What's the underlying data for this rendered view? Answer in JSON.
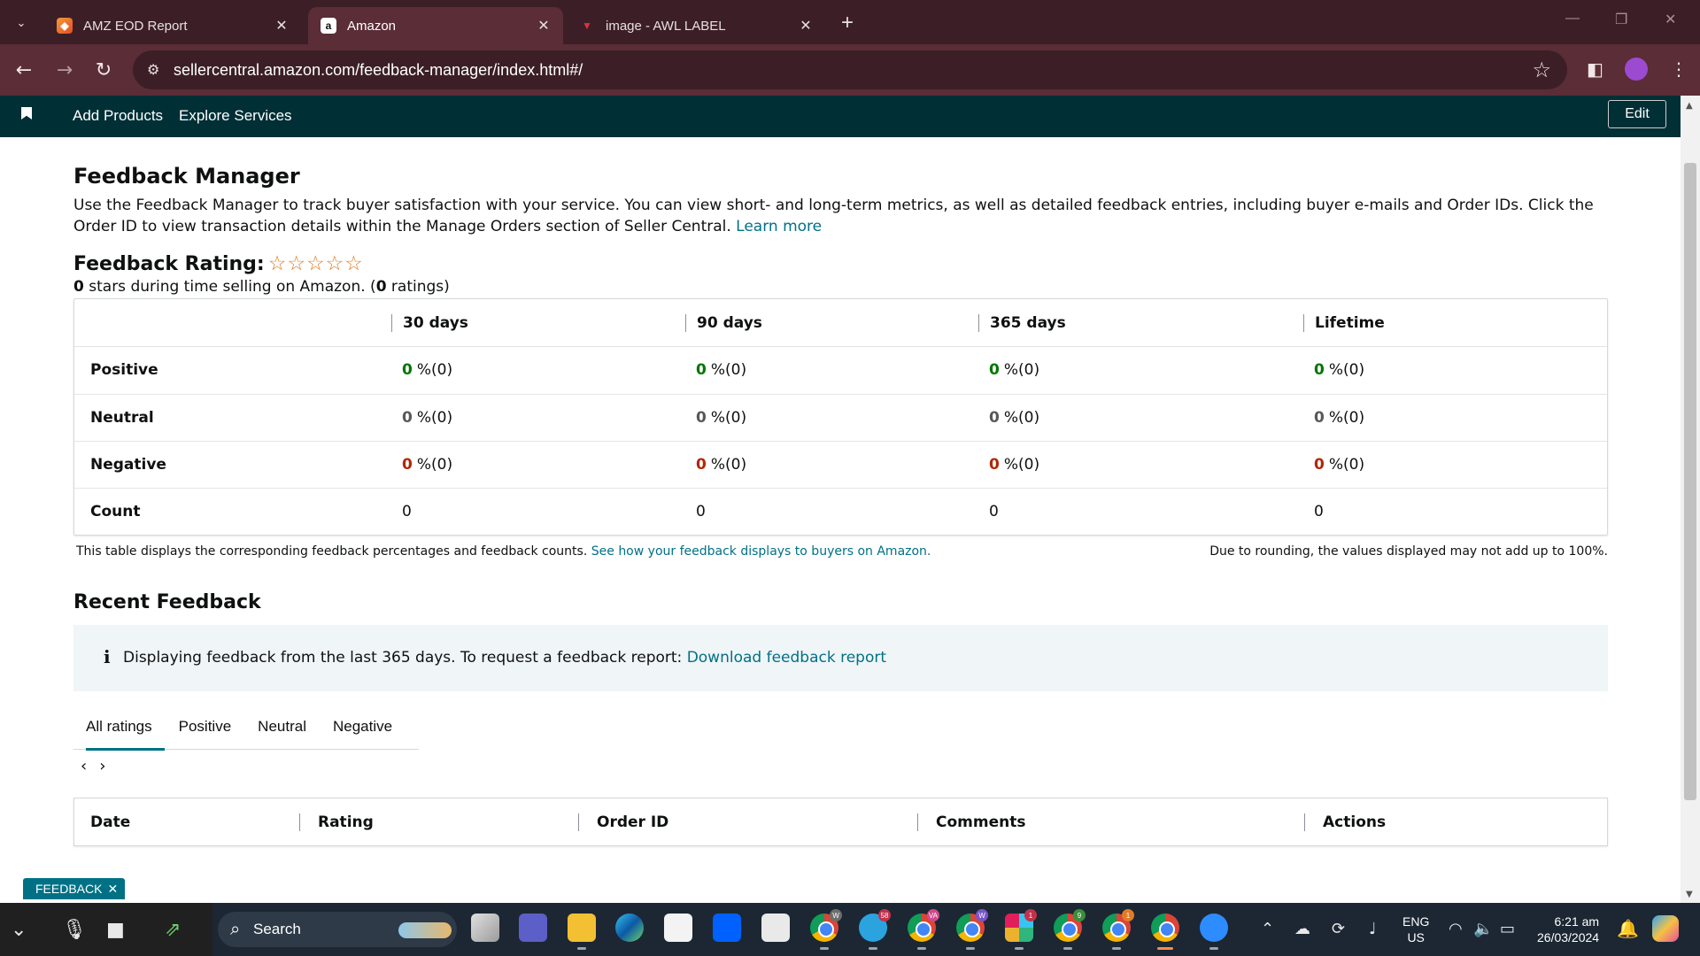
{
  "browser": {
    "tabs": [
      {
        "title": "AMZ EOD Report",
        "favicon": "amz-eod-favicon",
        "active": false
      },
      {
        "title": "Amazon",
        "favicon": "amazon-favicon",
        "active": true
      },
      {
        "title": "image - AWL LABEL",
        "favicon": "awl-favicon",
        "active": false
      }
    ],
    "url": "sellercentral.amazon.com/feedback-manager/index.html#/"
  },
  "seller_nav": {
    "links": [
      "Add Products",
      "Explore Services"
    ],
    "edit_label": "Edit"
  },
  "page": {
    "title": "Feedback Manager",
    "intro": "Use the Feedback Manager to track buyer satisfaction with your service. You can view short- and long-term metrics, as well as detailed feedback entries, including buyer e-mails and Order IDs. Click the Order ID to view transaction details within the Manage Orders section of Seller Central.",
    "learn_more": "Learn more",
    "rating_label": "Feedback Rating:",
    "stars": "☆☆☆☆☆",
    "rating_value": "0",
    "rating_text_a": " stars during time selling on Amazon. (",
    "rating_count": "0",
    "rating_text_b": " ratings)"
  },
  "metrics": {
    "columns": [
      "30 days",
      "90 days",
      "365 days",
      "Lifetime"
    ],
    "rows": [
      {
        "label": "Positive",
        "values": [
          "0",
          "0",
          "0",
          "0"
        ],
        "suffix": "%(0)"
      },
      {
        "label": "Neutral",
        "values": [
          "0",
          "0",
          "0",
          "0"
        ],
        "suffix": "%(0)"
      },
      {
        "label": "Negative",
        "values": [
          "0",
          "0",
          "0",
          "0"
        ],
        "suffix": "%(0)"
      },
      {
        "label": "Count",
        "values": [
          "0",
          "0",
          "0",
          "0"
        ]
      }
    ],
    "note": "This table displays the corresponding feedback percentages and feedback counts.",
    "note_link": "See how your feedback displays to buyers on Amazon.",
    "rounding_note": "Due to rounding, the values displayed may not add up to 100%."
  },
  "recent": {
    "title": "Recent Feedback",
    "alert_text": "Displaying feedback from the last 365 days. To request a feedback report:",
    "alert_link": "Download feedback report",
    "filter_tabs": [
      "All ratings",
      "Positive",
      "Neutral",
      "Negative"
    ],
    "active_tab": "All ratings",
    "table_headers": [
      "Date",
      "Rating",
      "Order ID",
      "Comments",
      "Actions"
    ]
  },
  "feedback_pill": "FEEDBACK",
  "taskbar": {
    "search_placeholder": "Search",
    "lang_line1": "ENG",
    "lang_line2": "US",
    "time": "6:21 am",
    "date": "26/03/2024",
    "badges": {
      "chrome1": "W",
      "telegram": "58",
      "chrome2": "VA",
      "chrome3": "W",
      "slack": "1",
      "chrome4": "9",
      "chrome5": "1"
    }
  },
  "colors": {
    "tabbar": "#3c1f26",
    "toolbar": "#5a2d37",
    "seller_nav": "#002f36",
    "link": "#007185",
    "positive": "#007600",
    "negative": "#b12704",
    "star": "#de7921"
  }
}
